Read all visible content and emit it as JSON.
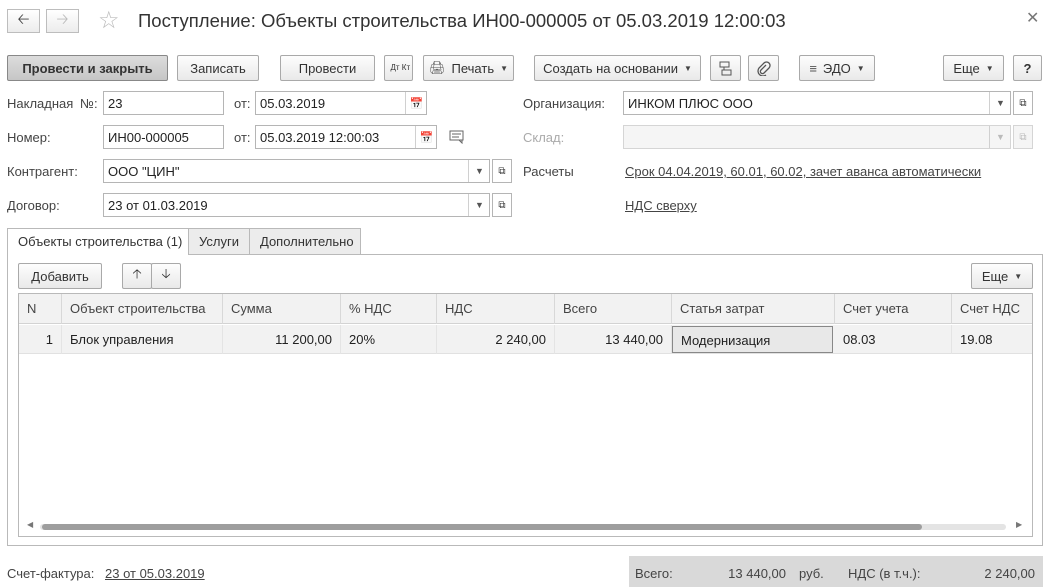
{
  "title": "Поступление: Объекты строительства ИН00-000005 от 05.03.2019 12:00:03",
  "toolbar": {
    "post_close": "Провести и закрыть",
    "save": "Записать",
    "post": "Провести",
    "dt_kt": "Дт Кт",
    "print": "Печать",
    "create_based": "Создать на основании",
    "edo": "ЭДО",
    "more": "Еще",
    "help": "?"
  },
  "form": {
    "invoice_label": "Накладная",
    "no_label": "№:",
    "invoice_no": "23",
    "from_label": "от:",
    "invoice_date": "05.03.2019",
    "number_label": "Номер:",
    "number": "ИН00-000005",
    "number_date": "05.03.2019 12:00:03",
    "counterparty_label": "Контрагент:",
    "counterparty": "ООО \"ЦИН\"",
    "contract_label": "Договор:",
    "contract": "23 от 01.03.2019",
    "org_label": "Организация:",
    "org": "ИНКОМ ПЛЮС ООО",
    "warehouse_label": "Склад:",
    "warehouse": "",
    "settlements_label": "Расчеты",
    "settlements_link": "Срок 04.04.2019, 60.01, 60.02, зачет аванса автоматически",
    "vat_link": "НДС сверху"
  },
  "tabs": [
    {
      "label": "Объекты строительства (1)",
      "active": true
    },
    {
      "label": "Услуги",
      "active": false
    },
    {
      "label": "Дополнительно",
      "active": false
    }
  ],
  "table_toolbar": {
    "add": "Добавить",
    "more": "Еще"
  },
  "table": {
    "columns": [
      "N",
      "Объект строительства",
      "Сумма",
      "% НДС",
      "НДС",
      "Всего",
      "Статья затрат",
      "Счет учета",
      "Счет НДС"
    ],
    "rows": [
      [
        "1",
        "Блок управления",
        "11 200,00",
        "20%",
        "2 240,00",
        "13 440,00",
        "Модернизация",
        "08.03",
        "19.08"
      ]
    ]
  },
  "footer": {
    "invoice_label": "Счет-фактура:",
    "invoice_link": "23 от 05.03.2019",
    "total_label": "Всего:",
    "total": "13 440,00",
    "currency": "руб.",
    "vat_label": "НДС (в т.ч.):",
    "vat": "2 240,00"
  }
}
